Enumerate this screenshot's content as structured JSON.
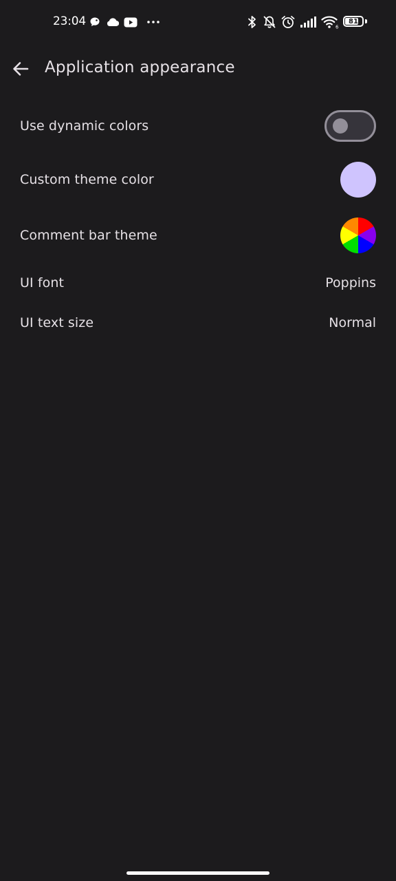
{
  "status_bar": {
    "time": "23:04",
    "battery_level": "81",
    "battery_fraction": 0.81,
    "left_icons": [
      "chat-bubble-icon",
      "cloud-icon",
      "youtube-icon",
      "more-dots-icon"
    ],
    "right_icons": [
      "bluetooth-icon",
      "notifications-off-icon",
      "alarm-icon",
      "signal-icon",
      "wifi-icon",
      "battery-icon"
    ],
    "wifi_badge": "6"
  },
  "app_bar": {
    "back_icon": "arrow-back-icon",
    "title": "Application appearance"
  },
  "settings": {
    "dynamic_colors": {
      "label": "Use dynamic colors",
      "enabled": false
    },
    "custom_theme_color": {
      "label": "Custom theme color",
      "color": "#cfc4fe"
    },
    "comment_bar_theme": {
      "label": "Comment bar theme",
      "colors": [
        "#ff0000",
        "#8800ee",
        "#0000ff",
        "#00dd00",
        "#ffff00",
        "#ff8800"
      ]
    },
    "ui_font": {
      "label": "UI font",
      "value": "Poppins"
    },
    "ui_text_size": {
      "label": "UI text size",
      "value": "Normal"
    }
  },
  "colors": {
    "background": "#1c1b1d",
    "text": "#e6e1e6",
    "switch_outline": "#938f99"
  }
}
